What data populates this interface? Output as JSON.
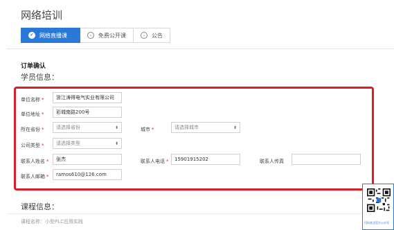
{
  "page": {
    "title": "网络培训"
  },
  "tabs": [
    {
      "label": "网络直播课",
      "active": true
    },
    {
      "label": "免费公开课",
      "active": false
    },
    {
      "label": "公告",
      "active": false
    }
  ],
  "order": {
    "heading": "订单确认",
    "student_heading": "学员信息：",
    "fields": {
      "company_name": {
        "label": "单位名称",
        "value": "浙江涛得电气实业有限公司"
      },
      "company_address": {
        "label": "单位地址",
        "value": "彩城南路200号"
      },
      "province": {
        "label": "所在省份",
        "placeholder": "请选择省份"
      },
      "city": {
        "label": "城市",
        "placeholder": "请选择城市"
      },
      "company_type": {
        "label": "公司类型",
        "placeholder": "请选择类型"
      },
      "contact_name": {
        "label": "联系人姓名",
        "value": "张杰"
      },
      "contact_phone": {
        "label": "联系人电话",
        "value": "15901915202"
      },
      "contact_fax": {
        "label": "联系人传真",
        "value": ""
      },
      "contact_email": {
        "label": "联系人邮箱",
        "value": "ramos610@126.com"
      }
    },
    "required_mark": "*"
  },
  "course": {
    "heading": "课程信息：",
    "name_text": "课程名称：小型PLC应用实践"
  },
  "qr": {
    "caption": "扫码关注官方公众号"
  },
  "colors": {
    "accent": "#2a79d8",
    "highlight_box": "#d81f27"
  },
  "icons": {
    "tab_active": "check-circle-icon",
    "tab_inactive": "chevron-down-circle-icon",
    "select": "updown-caret-icon"
  }
}
